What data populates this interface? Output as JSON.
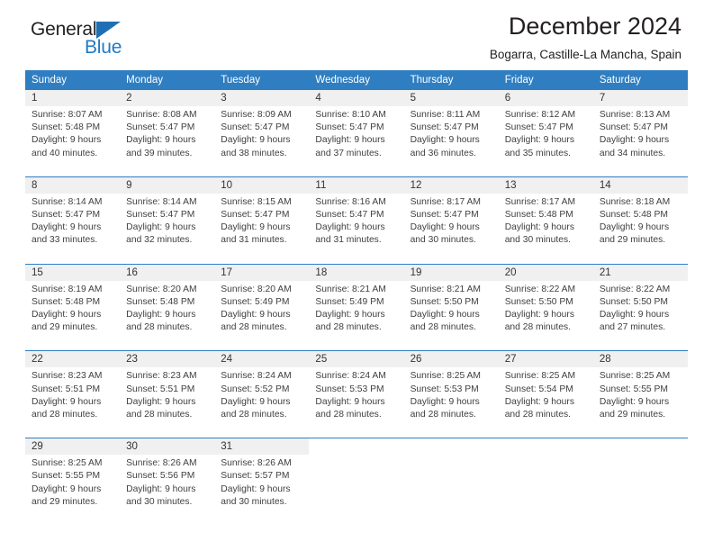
{
  "brand": {
    "word_top": "General",
    "word_bottom": "Blue",
    "triangle_color": "#1f6fb4",
    "blue_color": "#1f7ac4"
  },
  "header": {
    "title": "December 2024",
    "subtitle": "Bogarra, Castille-La Mancha, Spain"
  },
  "colors": {
    "header_bar": "#2f7ec1",
    "daynum_band": "#f0f0f0",
    "text": "#404040"
  },
  "weekday_headers": [
    "Sunday",
    "Monday",
    "Tuesday",
    "Wednesday",
    "Thursday",
    "Friday",
    "Saturday"
  ],
  "weeks": [
    {
      "days": [
        {
          "num": "1",
          "sunrise": "Sunrise: 8:07 AM",
          "sunset": "Sunset: 5:48 PM",
          "daylight_line1": "Daylight: 9 hours",
          "daylight_line2": "and 40 minutes."
        },
        {
          "num": "2",
          "sunrise": "Sunrise: 8:08 AM",
          "sunset": "Sunset: 5:47 PM",
          "daylight_line1": "Daylight: 9 hours",
          "daylight_line2": "and 39 minutes."
        },
        {
          "num": "3",
          "sunrise": "Sunrise: 8:09 AM",
          "sunset": "Sunset: 5:47 PM",
          "daylight_line1": "Daylight: 9 hours",
          "daylight_line2": "and 38 minutes."
        },
        {
          "num": "4",
          "sunrise": "Sunrise: 8:10 AM",
          "sunset": "Sunset: 5:47 PM",
          "daylight_line1": "Daylight: 9 hours",
          "daylight_line2": "and 37 minutes."
        },
        {
          "num": "5",
          "sunrise": "Sunrise: 8:11 AM",
          "sunset": "Sunset: 5:47 PM",
          "daylight_line1": "Daylight: 9 hours",
          "daylight_line2": "and 36 minutes."
        },
        {
          "num": "6",
          "sunrise": "Sunrise: 8:12 AM",
          "sunset": "Sunset: 5:47 PM",
          "daylight_line1": "Daylight: 9 hours",
          "daylight_line2": "and 35 minutes."
        },
        {
          "num": "7",
          "sunrise": "Sunrise: 8:13 AM",
          "sunset": "Sunset: 5:47 PM",
          "daylight_line1": "Daylight: 9 hours",
          "daylight_line2": "and 34 minutes."
        }
      ]
    },
    {
      "days": [
        {
          "num": "8",
          "sunrise": "Sunrise: 8:14 AM",
          "sunset": "Sunset: 5:47 PM",
          "daylight_line1": "Daylight: 9 hours",
          "daylight_line2": "and 33 minutes."
        },
        {
          "num": "9",
          "sunrise": "Sunrise: 8:14 AM",
          "sunset": "Sunset: 5:47 PM",
          "daylight_line1": "Daylight: 9 hours",
          "daylight_line2": "and 32 minutes."
        },
        {
          "num": "10",
          "sunrise": "Sunrise: 8:15 AM",
          "sunset": "Sunset: 5:47 PM",
          "daylight_line1": "Daylight: 9 hours",
          "daylight_line2": "and 31 minutes."
        },
        {
          "num": "11",
          "sunrise": "Sunrise: 8:16 AM",
          "sunset": "Sunset: 5:47 PM",
          "daylight_line1": "Daylight: 9 hours",
          "daylight_line2": "and 31 minutes."
        },
        {
          "num": "12",
          "sunrise": "Sunrise: 8:17 AM",
          "sunset": "Sunset: 5:47 PM",
          "daylight_line1": "Daylight: 9 hours",
          "daylight_line2": "and 30 minutes."
        },
        {
          "num": "13",
          "sunrise": "Sunrise: 8:17 AM",
          "sunset": "Sunset: 5:48 PM",
          "daylight_line1": "Daylight: 9 hours",
          "daylight_line2": "and 30 minutes."
        },
        {
          "num": "14",
          "sunrise": "Sunrise: 8:18 AM",
          "sunset": "Sunset: 5:48 PM",
          "daylight_line1": "Daylight: 9 hours",
          "daylight_line2": "and 29 minutes."
        }
      ]
    },
    {
      "days": [
        {
          "num": "15",
          "sunrise": "Sunrise: 8:19 AM",
          "sunset": "Sunset: 5:48 PM",
          "daylight_line1": "Daylight: 9 hours",
          "daylight_line2": "and 29 minutes."
        },
        {
          "num": "16",
          "sunrise": "Sunrise: 8:20 AM",
          "sunset": "Sunset: 5:48 PM",
          "daylight_line1": "Daylight: 9 hours",
          "daylight_line2": "and 28 minutes."
        },
        {
          "num": "17",
          "sunrise": "Sunrise: 8:20 AM",
          "sunset": "Sunset: 5:49 PM",
          "daylight_line1": "Daylight: 9 hours",
          "daylight_line2": "and 28 minutes."
        },
        {
          "num": "18",
          "sunrise": "Sunrise: 8:21 AM",
          "sunset": "Sunset: 5:49 PM",
          "daylight_line1": "Daylight: 9 hours",
          "daylight_line2": "and 28 minutes."
        },
        {
          "num": "19",
          "sunrise": "Sunrise: 8:21 AM",
          "sunset": "Sunset: 5:50 PM",
          "daylight_line1": "Daylight: 9 hours",
          "daylight_line2": "and 28 minutes."
        },
        {
          "num": "20",
          "sunrise": "Sunrise: 8:22 AM",
          "sunset": "Sunset: 5:50 PM",
          "daylight_line1": "Daylight: 9 hours",
          "daylight_line2": "and 28 minutes."
        },
        {
          "num": "21",
          "sunrise": "Sunrise: 8:22 AM",
          "sunset": "Sunset: 5:50 PM",
          "daylight_line1": "Daylight: 9 hours",
          "daylight_line2": "and 27 minutes."
        }
      ]
    },
    {
      "days": [
        {
          "num": "22",
          "sunrise": "Sunrise: 8:23 AM",
          "sunset": "Sunset: 5:51 PM",
          "daylight_line1": "Daylight: 9 hours",
          "daylight_line2": "and 28 minutes."
        },
        {
          "num": "23",
          "sunrise": "Sunrise: 8:23 AM",
          "sunset": "Sunset: 5:51 PM",
          "daylight_line1": "Daylight: 9 hours",
          "daylight_line2": "and 28 minutes."
        },
        {
          "num": "24",
          "sunrise": "Sunrise: 8:24 AM",
          "sunset": "Sunset: 5:52 PM",
          "daylight_line1": "Daylight: 9 hours",
          "daylight_line2": "and 28 minutes."
        },
        {
          "num": "25",
          "sunrise": "Sunrise: 8:24 AM",
          "sunset": "Sunset: 5:53 PM",
          "daylight_line1": "Daylight: 9 hours",
          "daylight_line2": "and 28 minutes."
        },
        {
          "num": "26",
          "sunrise": "Sunrise: 8:25 AM",
          "sunset": "Sunset: 5:53 PM",
          "daylight_line1": "Daylight: 9 hours",
          "daylight_line2": "and 28 minutes."
        },
        {
          "num": "27",
          "sunrise": "Sunrise: 8:25 AM",
          "sunset": "Sunset: 5:54 PM",
          "daylight_line1": "Daylight: 9 hours",
          "daylight_line2": "and 28 minutes."
        },
        {
          "num": "28",
          "sunrise": "Sunrise: 8:25 AM",
          "sunset": "Sunset: 5:55 PM",
          "daylight_line1": "Daylight: 9 hours",
          "daylight_line2": "and 29 minutes."
        }
      ]
    },
    {
      "days": [
        {
          "num": "29",
          "sunrise": "Sunrise: 8:25 AM",
          "sunset": "Sunset: 5:55 PM",
          "daylight_line1": "Daylight: 9 hours",
          "daylight_line2": "and 29 minutes."
        },
        {
          "num": "30",
          "sunrise": "Sunrise: 8:26 AM",
          "sunset": "Sunset: 5:56 PM",
          "daylight_line1": "Daylight: 9 hours",
          "daylight_line2": "and 30 minutes."
        },
        {
          "num": "31",
          "sunrise": "Sunrise: 8:26 AM",
          "sunset": "Sunset: 5:57 PM",
          "daylight_line1": "Daylight: 9 hours",
          "daylight_line2": "and 30 minutes."
        },
        {
          "num": "",
          "sunrise": "",
          "sunset": "",
          "daylight_line1": "",
          "daylight_line2": ""
        },
        {
          "num": "",
          "sunrise": "",
          "sunset": "",
          "daylight_line1": "",
          "daylight_line2": ""
        },
        {
          "num": "",
          "sunrise": "",
          "sunset": "",
          "daylight_line1": "",
          "daylight_line2": ""
        },
        {
          "num": "",
          "sunrise": "",
          "sunset": "",
          "daylight_line1": "",
          "daylight_line2": ""
        }
      ]
    }
  ]
}
